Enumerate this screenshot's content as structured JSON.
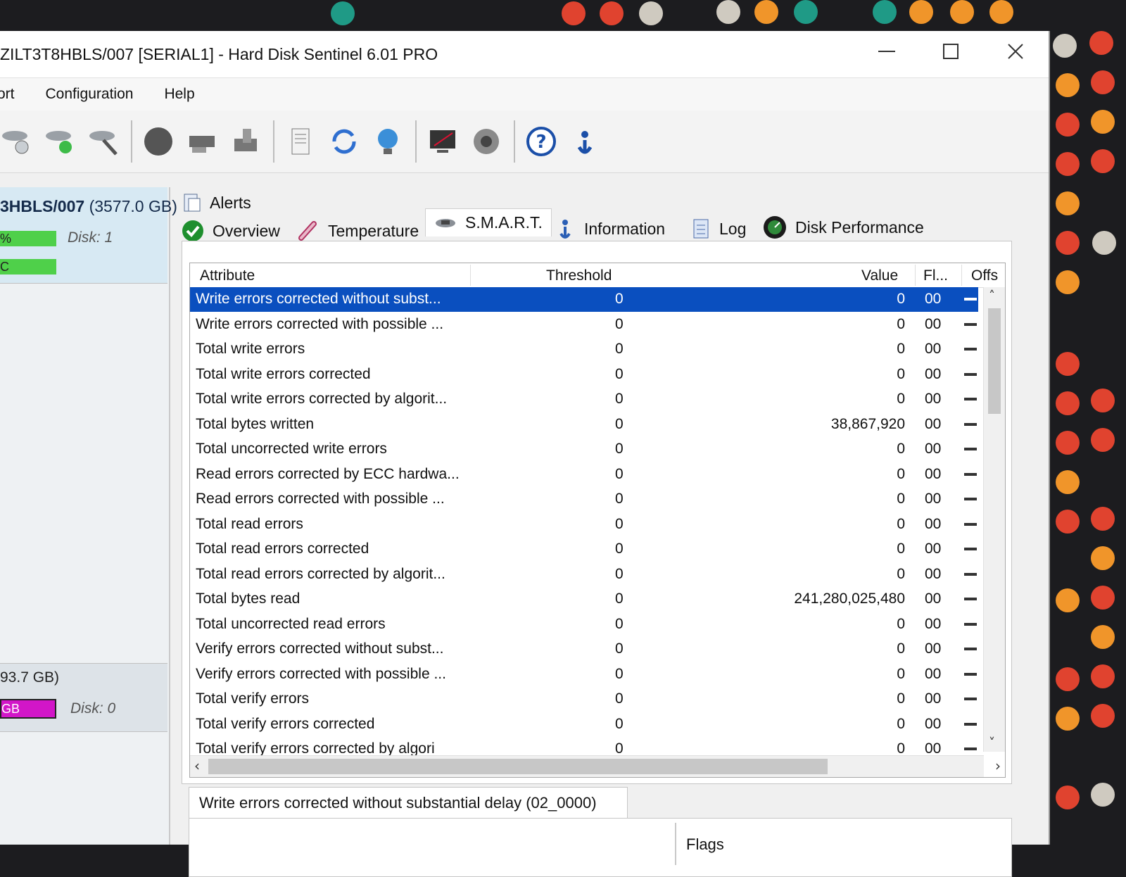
{
  "window": {
    "title": "ZILT3T8HBLS/007 [SERIAL1]  -  Hard Disk Sentinel 6.01 PRO"
  },
  "menu": {
    "items": [
      "ort",
      "Configuration",
      "Help"
    ]
  },
  "toolbar": {
    "icons": [
      "disk-refresh-icon",
      "disk-ok-icon",
      "disk-tools-icon",
      "disk-surface-icon",
      "disk-eject-icon",
      "disk-shield-icon",
      "report-icon",
      "refresh-icon",
      "network-icon",
      "monitor-icon",
      "sound-icon",
      "help-icon",
      "info-icon"
    ]
  },
  "left_panel": {
    "disk1": {
      "name": "3HBLS/007",
      "size": "(3577.0 GB)",
      "health_label": "%",
      "temp_label": "C",
      "disk_label": "Disk: 1"
    },
    "disk0": {
      "size": "93.7 GB)",
      "bar_label": "GB",
      "disk_label": "Disk: 0"
    }
  },
  "tabs": {
    "alerts": "Alerts",
    "overview": "Overview",
    "temperature": "Temperature",
    "smart": "S.M.A.R.T.",
    "information": "Information",
    "log": "Log",
    "disk_performance": "Disk Performance",
    "active": "S.M.A.R.T."
  },
  "table": {
    "headers": {
      "attribute": "Attribute",
      "threshold": "Threshold",
      "value": "Value",
      "flags": "Fl...",
      "offset": "Offs"
    },
    "rows": [
      {
        "attribute": "Write errors corrected without subst...",
        "threshold": "0",
        "value": "0",
        "flags": "00"
      },
      {
        "attribute": "Write errors corrected with possible ...",
        "threshold": "0",
        "value": "0",
        "flags": "00"
      },
      {
        "attribute": "Total write errors",
        "threshold": "0",
        "value": "0",
        "flags": "00"
      },
      {
        "attribute": "Total write errors corrected",
        "threshold": "0",
        "value": "0",
        "flags": "00"
      },
      {
        "attribute": "Total write errors corrected by algorit...",
        "threshold": "0",
        "value": "0",
        "flags": "00"
      },
      {
        "attribute": "Total bytes written",
        "threshold": "0",
        "value": "38,867,920",
        "flags": "00"
      },
      {
        "attribute": "Total uncorrected write errors",
        "threshold": "0",
        "value": "0",
        "flags": "00"
      },
      {
        "attribute": "Read errors corrected by ECC hardwa...",
        "threshold": "0",
        "value": "0",
        "flags": "00"
      },
      {
        "attribute": "Read errors corrected with possible ...",
        "threshold": "0",
        "value": "0",
        "flags": "00"
      },
      {
        "attribute": "Total read errors",
        "threshold": "0",
        "value": "0",
        "flags": "00"
      },
      {
        "attribute": "Total read errors corrected",
        "threshold": "0",
        "value": "0",
        "flags": "00"
      },
      {
        "attribute": "Total read errors corrected by algorit...",
        "threshold": "0",
        "value": "0",
        "flags": "00"
      },
      {
        "attribute": "Total bytes read",
        "threshold": "0",
        "value": "241,280,025,480",
        "flags": "00"
      },
      {
        "attribute": "Total uncorrected read errors",
        "threshold": "0",
        "value": "0",
        "flags": "00"
      },
      {
        "attribute": "Verify errors corrected without subst...",
        "threshold": "0",
        "value": "0",
        "flags": "00"
      },
      {
        "attribute": "Verify errors corrected with possible ...",
        "threshold": "0",
        "value": "0",
        "flags": "00"
      },
      {
        "attribute": "Total verify errors",
        "threshold": "0",
        "value": "0",
        "flags": "00"
      },
      {
        "attribute": "Total verify errors corrected",
        "threshold": "0",
        "value": "0",
        "flags": "00"
      },
      {
        "attribute": "Total verify errors corrected by algori",
        "threshold": "0",
        "value": "0",
        "flags": "00"
      }
    ],
    "selected_index": 0
  },
  "description": {
    "text": "Write errors corrected without substantial delay (02_0000)",
    "flags_label": "Flags"
  },
  "colors": {
    "selection": "#0a4fbf",
    "health_bar": "#4fd04a",
    "disk0_bar": "#d216c8"
  }
}
